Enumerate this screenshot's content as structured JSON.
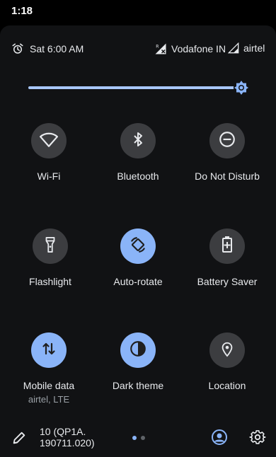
{
  "status_bar": {
    "time": "1:18"
  },
  "header": {
    "alarm_text": "Sat 6:00 AM",
    "carrier_1": "Vodafone IN",
    "carrier_2": "airtel"
  },
  "brightness": {
    "level_fraction": 0.94
  },
  "tiles": [
    {
      "label": "Wi-Fi",
      "icon": "wifi-icon",
      "active": false
    },
    {
      "label": "Bluetooth",
      "icon": "bluetooth-icon",
      "active": false
    },
    {
      "label": "Do Not Disturb",
      "icon": "do-not-disturb-icon",
      "active": false
    },
    {
      "label": "Flashlight",
      "icon": "flashlight-icon",
      "active": false
    },
    {
      "label": "Auto-rotate",
      "icon": "auto-rotate-icon",
      "active": true
    },
    {
      "label": "Battery Saver",
      "icon": "battery-saver-icon",
      "active": false
    },
    {
      "label": "Mobile data",
      "sublabel": "airtel, LTE",
      "icon": "mobile-data-icon",
      "active": true
    },
    {
      "label": "Dark theme",
      "icon": "dark-theme-icon",
      "active": true
    },
    {
      "label": "Location",
      "icon": "location-icon",
      "active": false
    }
  ],
  "footer": {
    "build_line1": "10 (QP1A.",
    "build_line2": "190711.020)",
    "page_count": 2,
    "current_page": 1
  },
  "colors": {
    "accent": "#8ab4f8",
    "tile_inactive": "#3c3d40",
    "panel_bg": "#111214",
    "text": "#e8eaed"
  }
}
